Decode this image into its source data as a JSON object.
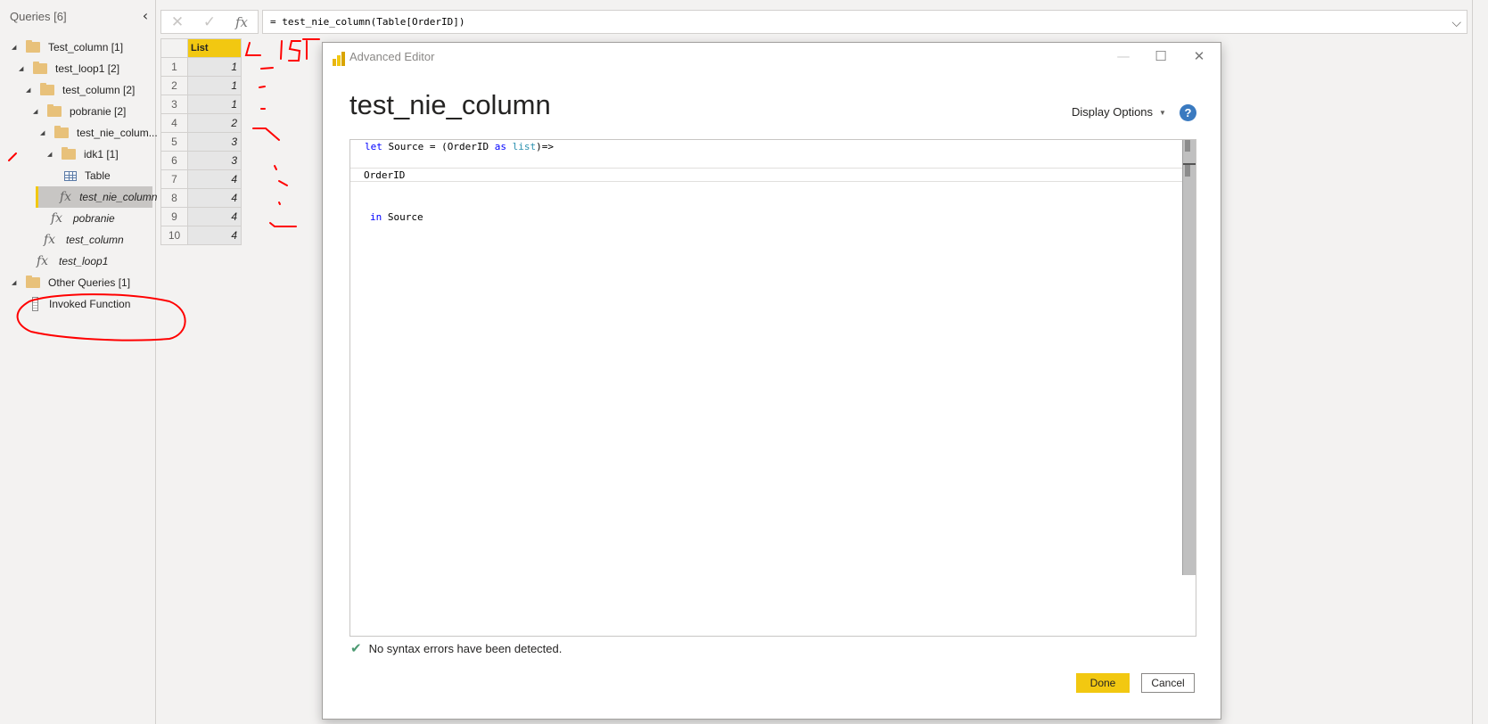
{
  "queries_panel": {
    "title": "Queries [6]",
    "collapse_icon": "chevron-left-icon",
    "items": [
      {
        "label": "Test_column [1]",
        "type": "folder",
        "expanded": true
      },
      {
        "label": "test_loop1 [2]",
        "type": "folder",
        "expanded": true
      },
      {
        "label": "test_column [2]",
        "type": "folder",
        "expanded": true
      },
      {
        "label": "pobranie [2]",
        "type": "folder",
        "expanded": true
      },
      {
        "label": "test_nie_colum...",
        "type": "folder",
        "expanded": true
      },
      {
        "label": "idk1 [1]",
        "type": "folder",
        "expanded": true
      },
      {
        "label": "Table",
        "type": "table"
      },
      {
        "label": "test_nie_column",
        "type": "function",
        "selected": true
      },
      {
        "label": "pobranie",
        "type": "function"
      },
      {
        "label": "test_column",
        "type": "function"
      },
      {
        "label": "test_loop1",
        "type": "function"
      },
      {
        "label": "Other Queries [1]",
        "type": "folder",
        "expanded": true
      },
      {
        "label": "Invoked Function",
        "type": "query"
      }
    ]
  },
  "formula_bar": {
    "cancel_icon": "close-icon",
    "confirm_icon": "checkmark-icon",
    "fx_label": "fx",
    "formula": "= test_nie_column(Table[OrderID])",
    "expand_icon": "chevron-down-icon"
  },
  "grid": {
    "column_header": "List",
    "rows": [
      {
        "n": "1",
        "value": "1"
      },
      {
        "n": "2",
        "value": "1"
      },
      {
        "n": "3",
        "value": "1"
      },
      {
        "n": "4",
        "value": "2"
      },
      {
        "n": "5",
        "value": "3"
      },
      {
        "n": "6",
        "value": "3"
      },
      {
        "n": "7",
        "value": "4"
      },
      {
        "n": "8",
        "value": "4"
      },
      {
        "n": "9",
        "value": "4"
      },
      {
        "n": "10",
        "value": "4"
      }
    ]
  },
  "annotations": {
    "handwritten_text": "LIST",
    "color": "#ff0000"
  },
  "dialog": {
    "title": "Advanced Editor",
    "minimize_label": "—",
    "maximize_label": "☐",
    "close_label": "✕",
    "query_name": "test_nie_column",
    "display_options": "Display Options",
    "display_caret": "▼",
    "help_label": "?",
    "code": {
      "line1": {
        "kw1": "let",
        "t1": " Source = (OrderID ",
        "kw2": "as",
        "t2": " ",
        "type": "list",
        "t3": ")=>"
      },
      "line2": "OrderID",
      "line3": {
        "kw": "in",
        "t": " Source"
      }
    },
    "status_icon": "✔",
    "status": "No syntax errors have been detected.",
    "done_label": "Done",
    "cancel_label": "Cancel"
  }
}
